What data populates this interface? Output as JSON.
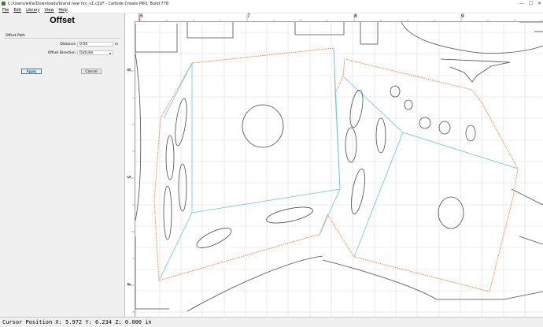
{
  "window": {
    "title": "C:/Users/willa/Downloads/brand new hrc_v1.c2d* - Carbide Create PRO, Build 778",
    "buttons": [
      "—",
      "☐",
      "✕"
    ]
  },
  "menu": [
    "File",
    "Edit",
    "Library",
    "View",
    "Help"
  ],
  "panel": {
    "title": "Offset",
    "group": "Offset Path",
    "distance_label": "Distance",
    "distance_value": "0.04",
    "distance_unit": "in",
    "direction_label": "Offset Direction",
    "direction_value": "Outside",
    "apply_label": "Apply",
    "cancel_label": "Cancel"
  },
  "ruler": {
    "top_labels": [
      "6",
      "7",
      "8",
      "9"
    ],
    "left_labels": [
      "6",
      "5",
      "4"
    ]
  },
  "status": {
    "text": "Cursor Position X: 5.972 Y: 6.234 Z: 0.000 in"
  },
  "colors": {
    "offset_path": "#f07a2a",
    "selected_path": "#5bc8e8",
    "vector": "#4a4a4a",
    "grid": "#dcdcdc"
  }
}
